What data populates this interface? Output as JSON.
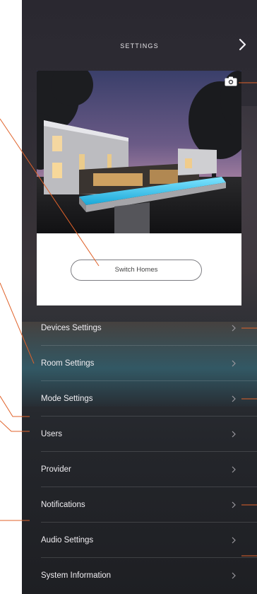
{
  "header": {
    "title": "SETTINGS"
  },
  "card": {
    "switch_homes_label": "Switch Homes"
  },
  "menu": {
    "items": [
      {
        "label": "Devices Settings"
      },
      {
        "label": "Room Settings"
      },
      {
        "label": "Mode Settings"
      },
      {
        "label": "Users"
      },
      {
        "label": "Provider"
      },
      {
        "label": "Notifications"
      },
      {
        "label": "Audio Settings"
      },
      {
        "label": "System Information"
      }
    ]
  },
  "icons": {
    "header_right": "chevron-right-icon",
    "photo_action": "camera-icon",
    "menu_item": "chevron-right-icon"
  },
  "colors": {
    "callout": "#e0622a",
    "menu_text": "#f0eef2",
    "card_bg": "#ffffff"
  }
}
